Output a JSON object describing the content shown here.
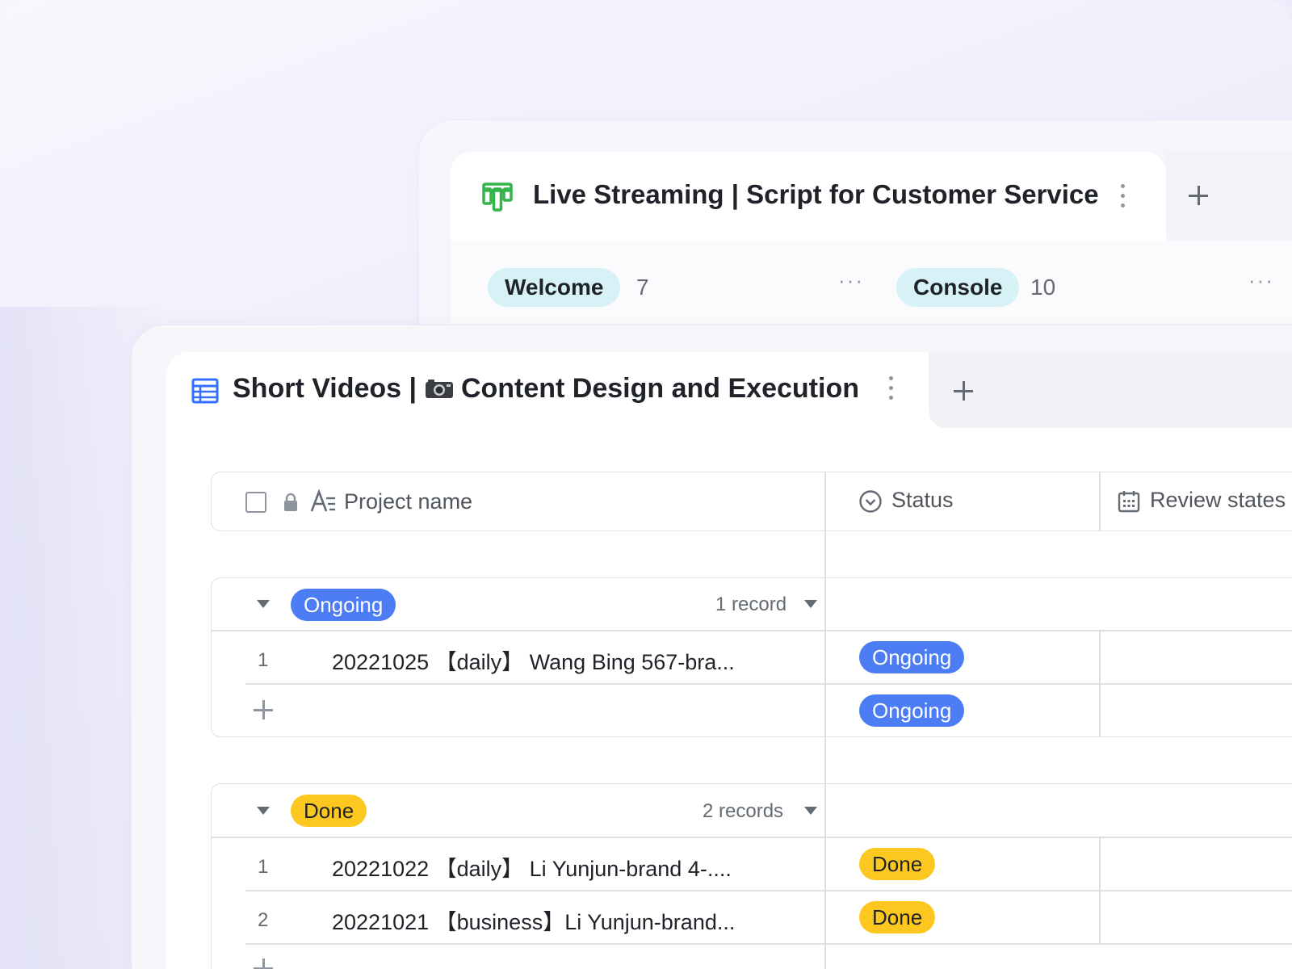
{
  "back_view": {
    "title": "Live Streaming | Script for Customer Service",
    "columns": [
      {
        "label": "Welcome",
        "count": "7",
        "more": "···"
      },
      {
        "label": "Console",
        "count": "10",
        "more": "···"
      }
    ],
    "colors": {
      "icon": "#34b44a",
      "tag_bg": "#d7f2f6"
    }
  },
  "front_view": {
    "title_prefix": "Short Videos | ",
    "title_suffix": " Content Design and Execution",
    "camera_icon": "camera-icon",
    "header": {
      "project_name": "Project name",
      "status": "Status",
      "review": "Review states"
    },
    "groups": [
      {
        "label": "Ongoing",
        "count": "1 record",
        "rows": [
          {
            "num": "1",
            "name": "20221025 【daily】 Wang Bing 567-bra...",
            "status": "Ongoing"
          }
        ],
        "add_row_status": "Ongoing"
      },
      {
        "label": "Done",
        "count": "2 records",
        "rows": [
          {
            "num": "1",
            "name": "20221022 【daily】 Li Yunjun-brand 4-....",
            "status": "Done"
          },
          {
            "num": "2",
            "name": "20221021 【business】Li Yunjun-brand...",
            "status": "Done"
          }
        ]
      }
    ],
    "colors": {
      "ongoing": "#4c7df5",
      "done": "#fcc81f",
      "table_icon": "#3370ff"
    }
  }
}
